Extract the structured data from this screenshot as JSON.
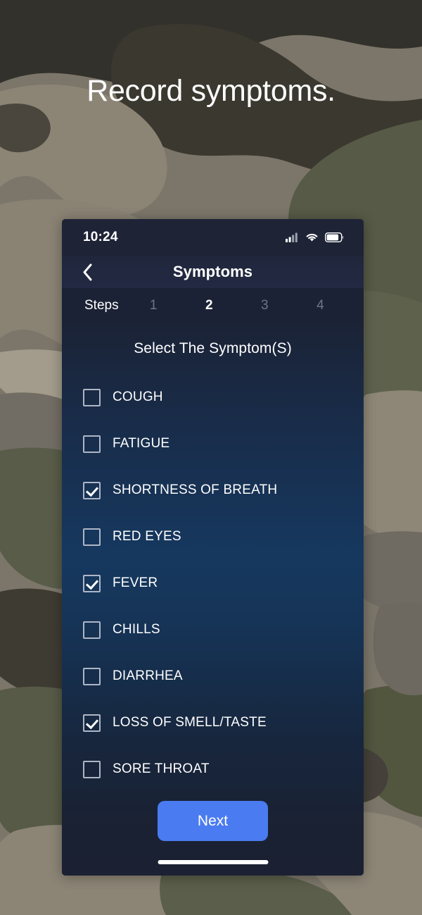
{
  "hero": {
    "title": "Record symptoms."
  },
  "phone": {
    "statusbar": {
      "time": "10:24",
      "icons": [
        "cellular-signal-icon",
        "wifi-icon",
        "battery-icon"
      ]
    },
    "navbar": {
      "back_icon": "chevron-left-icon",
      "title": "Symptoms"
    },
    "steps": {
      "label": "Steps",
      "items": [
        {
          "label": "1",
          "active": false
        },
        {
          "label": "2",
          "active": true
        },
        {
          "label": "3",
          "active": false
        },
        {
          "label": "4",
          "active": false
        }
      ]
    },
    "content": {
      "section_title": "Select The Symptom(S)",
      "symptoms": [
        {
          "label": "COUGH",
          "checked": false
        },
        {
          "label": "FATIGUE",
          "checked": false
        },
        {
          "label": "SHORTNESS OF BREATH",
          "checked": true
        },
        {
          "label": "RED EYES",
          "checked": false
        },
        {
          "label": "FEVER",
          "checked": true
        },
        {
          "label": "CHILLS",
          "checked": false
        },
        {
          "label": "DIARRHEA",
          "checked": false
        },
        {
          "label": "LOSS OF SMELL/TASTE",
          "checked": true
        },
        {
          "label": "SORE THROAT",
          "checked": false
        }
      ],
      "next_label": "Next"
    }
  },
  "colors": {
    "accent_blue": "#4a7bf0",
    "panel_dark": "#1b2133",
    "statusbar": "#1e2336",
    "content_mid_blue": "#16385f",
    "step_inactive": "#6f7487",
    "checkbox_border": "#aeb6c6",
    "camo_dark": "#33312b",
    "camo_olive": "#5c5f4c",
    "camo_khaki": "#8c8576",
    "camo_gray": "#76716a",
    "camo_light": "#a39c8c"
  }
}
